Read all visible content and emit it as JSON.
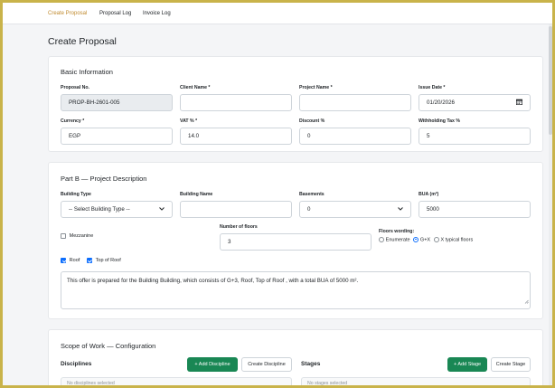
{
  "nav": {
    "items": [
      {
        "label": "Create Proposal",
        "active": true
      },
      {
        "label": "Proposal Log",
        "active": false
      },
      {
        "label": "Invoice Log",
        "active": false
      }
    ]
  },
  "page": {
    "title": "Create Proposal"
  },
  "basic": {
    "title": "Basic Information",
    "proposal_no": {
      "label": "Proposal No.",
      "value": "PROP-BH-2601-005"
    },
    "client_name": {
      "label": "Client Name *",
      "value": ""
    },
    "project_name": {
      "label": "Project Name *",
      "value": ""
    },
    "issue_date": {
      "label": "Issue Date *",
      "value": "01/20/2026"
    },
    "currency": {
      "label": "Currency *",
      "value": "EGP"
    },
    "vat": {
      "label": "VAT % *",
      "value": "14.0"
    },
    "discount": {
      "label": "Discount %",
      "value": "0"
    },
    "withholding": {
      "label": "Withholding Tax %",
      "value": "5"
    }
  },
  "partb": {
    "title": "Part B — Project Description",
    "building_type": {
      "label": "Building Type",
      "value": "-- Select Building Type --"
    },
    "building_name": {
      "label": "Building Name",
      "value": ""
    },
    "basements": {
      "label": "Basements",
      "value": "0"
    },
    "bua": {
      "label": "BUA (m²)",
      "value": "5000"
    },
    "mezzanine": {
      "label": "Mezzanine",
      "checked": false
    },
    "floors": {
      "label": "Number of floors",
      "value": "3"
    },
    "floors_wording": {
      "label": "Floors wording:",
      "options": [
        {
          "label": "Enumerate",
          "checked": false
        },
        {
          "label": "G+X",
          "checked": true
        },
        {
          "label": "X typical floors",
          "checked": false
        }
      ]
    },
    "roof": {
      "label": "Roof",
      "checked": true
    },
    "top_of_roof": {
      "label": "Top of Roof",
      "checked": true
    },
    "description": "This offer is prepared for the Building Building, which consists of G+3, Roof, Top of Roof , with a total BUA of 5000 m²."
  },
  "scope": {
    "title": "Scope of Work — Configuration",
    "disciplines": {
      "label": "Disciplines",
      "add_label": "+ Add Discipline",
      "create_label": "Create Discipline",
      "empty": "No disciplines selected"
    },
    "stages": {
      "label": "Stages",
      "add_label": "+ Add Stage",
      "create_label": "Create Stage",
      "empty": "No stages selected"
    }
  },
  "colors": {
    "accent_nav": "#c08a2e",
    "primary_button": "#198754",
    "checkbox": "#0d6efd",
    "frame_border": "#c9b34a"
  },
  "icons": {
    "calendar": "calendar-icon",
    "select_arrow": "chevron-down-icon"
  }
}
